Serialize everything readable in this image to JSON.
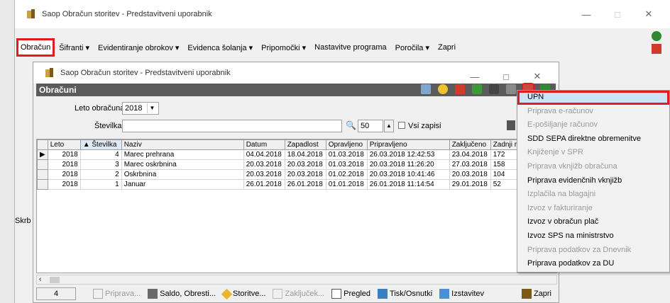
{
  "main_window": {
    "title": "Saop Obračun storitev - Predstavitveni uporabnik",
    "controls": [
      "—",
      "□",
      "✕"
    ]
  },
  "menubar": {
    "items": [
      {
        "label": "Obračun",
        "active": true
      },
      {
        "label": "Šifranti ▾"
      },
      {
        "label": "Evidentiranje obrokov ▾"
      },
      {
        "label": "Evidenca šolanja ▾"
      },
      {
        "label": "Pripomočki ▾"
      },
      {
        "label": "Nastavitve programa"
      },
      {
        "label": "Poročila ▾"
      },
      {
        "label": "Zapri"
      }
    ]
  },
  "side_label": "Skrb",
  "inner_window": {
    "title": "Saop Obračun storitev - Predstavitveni uporabnik",
    "controls": [
      "—",
      "□",
      "✕"
    ],
    "panel_title": "Obračuni",
    "filter": {
      "year_label": "Leto obračuna",
      "year_value": "2018",
      "number_label": "Številka",
      "number_value": "",
      "page_size": "50",
      "all_records_label": "Vsi zapisi"
    },
    "table": {
      "columns": [
        "Leto",
        "▲ Številka",
        "Naziv",
        "Datum",
        "Zapadlost",
        "Opravljeno",
        "Pripravljeno",
        "Zaključeno",
        "Zadnji ra"
      ],
      "rows": [
        [
          "2018",
          "4",
          "Marec prehrana",
          "04.04.2018",
          "18.04.2018",
          "01.03.2018",
          "26.03.2018 12:42:53",
          "23.04.2018",
          "172"
        ],
        [
          "2018",
          "3",
          "Marec oskrbnina",
          "20.03.2018",
          "20.03.2018",
          "01.03.2018",
          "20.03.2018 11:26:20",
          "27.03.2018",
          "158"
        ],
        [
          "2018",
          "2",
          "Oskrbnina",
          "20.03.2018",
          "20.03.2018",
          "01.02.2018",
          "20.03.2018 10:41:46",
          "20.03.2018",
          "104"
        ],
        [
          "2018",
          "1",
          "Januar",
          "26.01.2018",
          "26.01.2018",
          "01.01.2018",
          "26.01.2018 11:14:54",
          "29.01.2018",
          "52"
        ]
      ]
    },
    "statusbar": {
      "count": "4",
      "buttons": [
        {
          "label": "Priprava...",
          "enabled": false
        },
        {
          "label": "Saldo, Obresti...",
          "enabled": true
        },
        {
          "label": "Storitve...",
          "enabled": true
        },
        {
          "label": "Zaključek...",
          "enabled": false
        },
        {
          "label": "Pregled",
          "enabled": true
        },
        {
          "label": "Tisk/Osnutki",
          "enabled": true
        },
        {
          "label": "Izstavitev",
          "enabled": true
        }
      ],
      "close_label": "Zapri"
    }
  },
  "dropdown_menu": {
    "items": [
      {
        "label": "UPN",
        "enabled": true,
        "highlighted": true
      },
      {
        "label": "Priprava e-računov",
        "enabled": false
      },
      {
        "label": "E-pošiljanje računov",
        "enabled": false
      },
      {
        "label": "SDD SEPA direktne obremenitve",
        "enabled": true
      },
      {
        "label": "Knjiženje v SPR",
        "enabled": false
      },
      {
        "label": "Priprava vknjižb obračuna",
        "enabled": false
      },
      {
        "label": "Priprava evidenčnih vknjižb",
        "enabled": true
      },
      {
        "label": "Izplačila na blagajni",
        "enabled": false
      },
      {
        "label": "Izvoz v fakturiranje",
        "enabled": false
      },
      {
        "label": "Izvoz v obračun plač",
        "enabled": true
      },
      {
        "label": "Izvoz SPS na ministrstvo",
        "enabled": true
      },
      {
        "label": "Priprava podatkov za Dnevnik",
        "enabled": false
      },
      {
        "label": "Priprava podatkov za DU",
        "enabled": true
      }
    ]
  },
  "colors": {
    "highlight_border": "#e21b23",
    "panel_header": "#5b5b5b",
    "menu_hover": "#cce4f7"
  }
}
